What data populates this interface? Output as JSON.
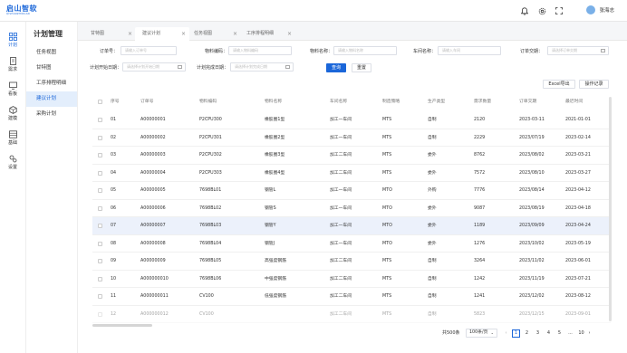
{
  "brand": {
    "name": "启山智软",
    "sub": "QISHANZHIRUAN"
  },
  "user": {
    "name": "张海志"
  },
  "sidebar": [
    {
      "label": "计划",
      "icon": "grid-icon",
      "active": true
    },
    {
      "label": "需求",
      "icon": "document-icon"
    },
    {
      "label": "看板",
      "icon": "monitor-icon"
    },
    {
      "label": "建模",
      "icon": "cube-icon"
    },
    {
      "label": "基础",
      "icon": "table-icon"
    },
    {
      "label": "设置",
      "icon": "gear-icon"
    }
  ],
  "subnav": {
    "title": "计划管理",
    "items": [
      "任务视图",
      "甘特图",
      "工序排程明细",
      "建议计划",
      "采购计划"
    ],
    "active_index": 3
  },
  "tabs": [
    "甘特图",
    "建议计划",
    "任务视图",
    "工序排程明细"
  ],
  "filters": {
    "order_no": {
      "label": "订单号：",
      "placeholder": "请输入订单号"
    },
    "material_code": {
      "label": "物料编码：",
      "placeholder": "请输入物料编码"
    },
    "material_name": {
      "label": "物料名称：",
      "placeholder": "请输入物料名称"
    },
    "workshop": {
      "label": "车间名称：",
      "placeholder": "请输入车间"
    },
    "order_delivery": {
      "label": "订单交期：",
      "placeholder": "请选择订单交期"
    },
    "plan_start": {
      "label": "计划开始日期：",
      "placeholder": "请选择计划开始日期"
    },
    "plan_end": {
      "label": "计划完成日期：",
      "placeholder": "请选择计划完成日期"
    }
  },
  "buttons": {
    "search": "查询",
    "reset": "重置",
    "export": "Excel导出",
    "log": "操作记录"
  },
  "table": {
    "columns": [
      "序号",
      "订单号",
      "物料编码",
      "物料名称",
      "车间名称",
      "制造策略",
      "生产类型",
      "需求数量",
      "订单交期",
      "最迟时间"
    ],
    "rows": [
      [
        "01",
        "A00000001",
        "P2CPU300",
        "橡胶圈1型",
        "加工一车间",
        "MTS",
        "自制",
        "2120",
        "2023-03-11",
        "2021-01-01"
      ],
      [
        "02",
        "A00000002",
        "P2CPU301",
        "橡胶圈2型",
        "加工一车间",
        "MTS",
        "自制",
        "2229",
        "2023/07/19",
        "2023-02-14"
      ],
      [
        "03",
        "A00000003",
        "P2CPU302",
        "橡胶圈3型",
        "加工二车间",
        "MTS",
        "委外",
        "8762",
        "2023/08/02",
        "2023-03-21"
      ],
      [
        "04",
        "A00000004",
        "P2CPU303",
        "橡胶圈4型",
        "加工二车间",
        "MTS",
        "委外",
        "7572",
        "2023/08/10",
        "2023-03-27"
      ],
      [
        "05",
        "A00000005",
        "7698BL01",
        "钢管L",
        "加工一车间",
        "MTO",
        "外购",
        "7776",
        "2023/08/14",
        "2023-04-12"
      ],
      [
        "06",
        "A00000006",
        "7698BL02",
        "钢管S",
        "加工一车间",
        "MTO",
        "委外",
        "9087",
        "2023/08/19",
        "2023-04-18"
      ],
      [
        "07",
        "A00000007",
        "7698BL03",
        "钢管Y",
        "加工一车间",
        "MTO",
        "委外",
        "1189",
        "2023/09/09",
        "2023-04-24"
      ],
      [
        "08",
        "A00000008",
        "7698BL04",
        "钢管J",
        "加工一车间",
        "MTO",
        "委外",
        "1276",
        "2023/10/02",
        "2023-05-19"
      ],
      [
        "09",
        "A00000009",
        "7698BL05",
        "高强度钢筋",
        "加工二车间",
        "MTS",
        "自制",
        "3264",
        "2023/11/02",
        "2023-06-01"
      ],
      [
        "10",
        "A000000010",
        "7698BL06",
        "中强度钢筋",
        "加工二车间",
        "MTS",
        "自制",
        "1242",
        "2023/11/19",
        "2023-07-21"
      ],
      [
        "11",
        "A000000011",
        "CV100",
        "低强度钢筋",
        "加工二车间",
        "MTS",
        "自制",
        "1241",
        "2023/12/02",
        "2023-08-12"
      ],
      [
        "12",
        "A000000012",
        "CV100",
        "",
        "加工二车间",
        "MTS",
        "自制",
        "5823",
        "2023/12/15",
        "2023-09-01"
      ]
    ],
    "highlight_row": 6
  },
  "pagination": {
    "total": "共500条",
    "page_size": "100条/页",
    "pages": [
      "1",
      "2",
      "3",
      "4",
      "5",
      "...",
      "10"
    ],
    "current": "1"
  },
  "colors": {
    "primary": "#1a66d9",
    "highlight_row": "#ecf1fb",
    "active_nav_bg": "#e3eefc"
  }
}
